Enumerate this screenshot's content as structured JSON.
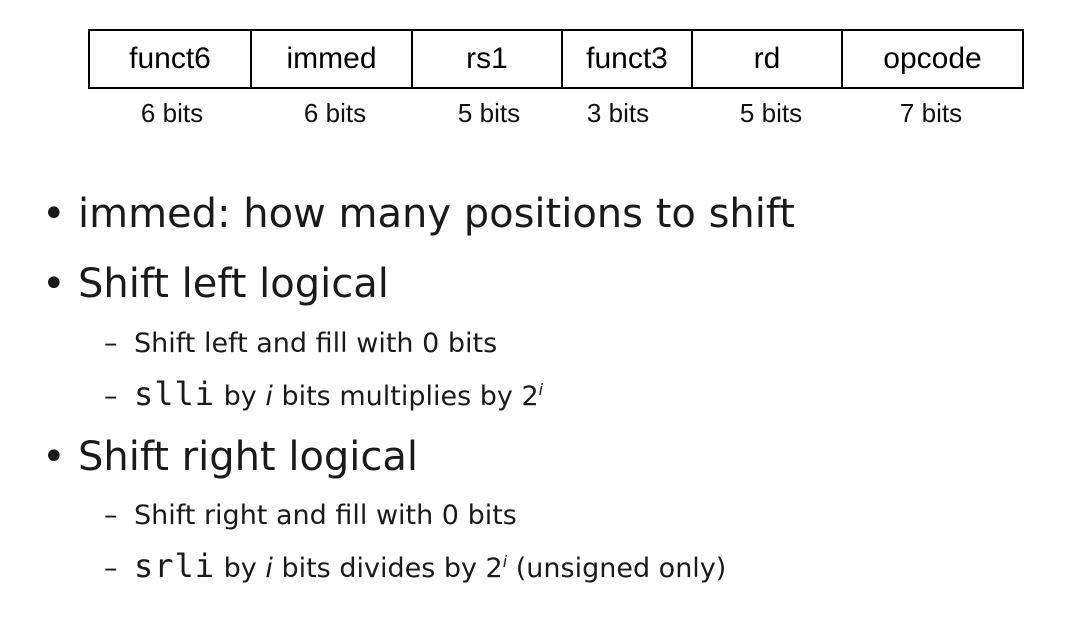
{
  "format": {
    "fields": [
      {
        "name": "funct6",
        "bits": "6 bits"
      },
      {
        "name": "immed",
        "bits": "6 bits"
      },
      {
        "name": "rs1",
        "bits": "5 bits"
      },
      {
        "name": "funct3",
        "bits": "3 bits"
      },
      {
        "name": "rd",
        "bits": "5 bits"
      },
      {
        "name": "opcode",
        "bits": "7 bits"
      }
    ]
  },
  "bullets": {
    "b1": {
      "bullet": "•",
      "text": "immed: how many positions to shift"
    },
    "b2": {
      "bullet": "•",
      "text": "Shift left logical"
    },
    "b2_sub1": {
      "dash": "–",
      "text": "Shift left and fill with 0 bits"
    },
    "b2_sub2": {
      "dash": "–",
      "code": "slli",
      "pre": " by ",
      "var": "i",
      "mid": " bits multiplies by 2",
      "exp": "i",
      "post": ""
    },
    "b3": {
      "bullet": "•",
      "text": "Shift right logical"
    },
    "b3_sub1": {
      "dash": "–",
      "text": "Shift right and fill with 0 bits"
    },
    "b3_sub2": {
      "dash": "–",
      "code": "srli",
      "pre": " by ",
      "var": "i",
      "mid": " bits divides by 2",
      "exp": "i",
      "post": " (unsigned only)"
    }
  }
}
